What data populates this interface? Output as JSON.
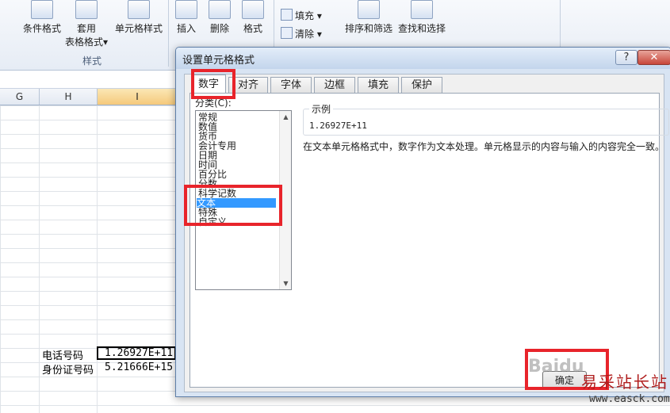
{
  "ribbon": {
    "conditional_format": "条件格式",
    "table_format_1": "套用",
    "table_format_2": "表格格式",
    "cell_style": "单元格样式",
    "styles_group": "样式",
    "insert": "插入",
    "delete": "删除",
    "format": "格式",
    "fill": "填充",
    "clear": "清除",
    "sort_filter": "排序和筛选",
    "find_select": "查找和选择"
  },
  "sheet": {
    "columns": [
      "G",
      "H",
      "I"
    ],
    "selected_column": "I",
    "rows": [
      {
        "label": "电话号码",
        "value": "1.26927E+11"
      },
      {
        "label": "身份证号码",
        "value": "5.21666E+15"
      }
    ]
  },
  "dialog": {
    "title": "设置单元格格式",
    "help": "?",
    "close": "✕",
    "tabs": [
      "数字",
      "对齐",
      "字体",
      "边框",
      "填充",
      "保护"
    ],
    "active_tab": "数字",
    "category_label": "分类(C):",
    "categories": [
      "常规",
      "数值",
      "货币",
      "会计专用",
      "日期",
      "时间",
      "百分比",
      "分数",
      "科学记数",
      "文本",
      "特殊",
      "自定义"
    ],
    "selected_category": "文本",
    "sample_label": "示例",
    "sample_value": "1.26927E+11",
    "description": "在文本单元格格式中，数字作为文本处理。单元格显示的内容与输入的内容完全一致。",
    "ok_button": "确定"
  },
  "watermark": {
    "line1": "Baidu",
    "line2": "易采站长站",
    "line3": "www.easck.com"
  },
  "colors": {
    "highlight": "#e8242b",
    "selection": "#3399ff"
  }
}
